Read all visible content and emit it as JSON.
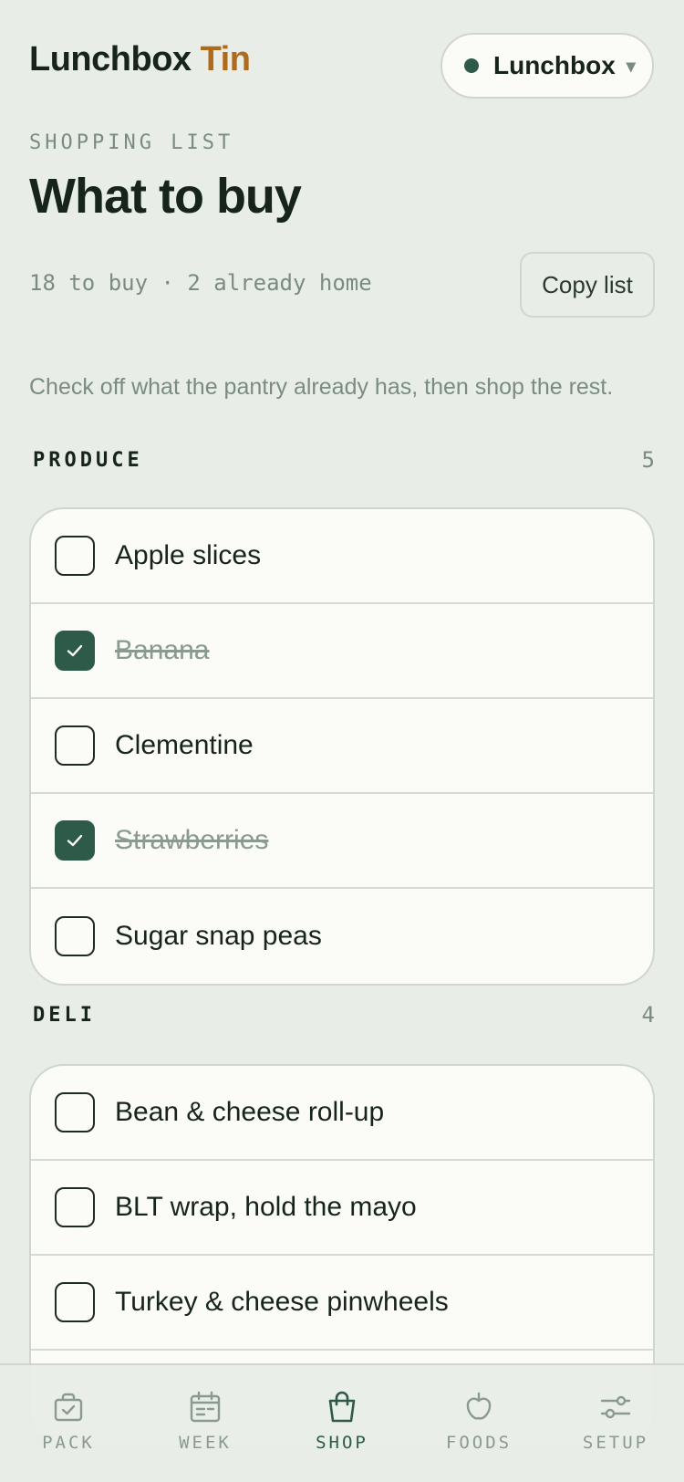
{
  "header": {
    "brand_main": "Lunchbox",
    "brand_accent": "Tin",
    "profile_label": "Lunchbox",
    "profile_chevron": "▾"
  },
  "page": {
    "eyebrow": "SHOPPING LIST",
    "title": "What to buy",
    "summary": "18 to buy · 2 already home",
    "copy_button": "Copy list",
    "helper": "Check off what the pantry already has, then shop the rest."
  },
  "sections": [
    {
      "name": "PRODUCE",
      "count": "5",
      "items": [
        {
          "label": "Apple slices",
          "checked": false
        },
        {
          "label": "Banana",
          "checked": true
        },
        {
          "label": "Clementine",
          "checked": false
        },
        {
          "label": "Strawberries",
          "checked": true
        },
        {
          "label": "Sugar snap peas",
          "checked": false
        }
      ]
    },
    {
      "name": "DELI",
      "count": "4",
      "items": [
        {
          "label": "Bean & cheese roll-up",
          "checked": false
        },
        {
          "label": "BLT wrap, hold the mayo",
          "checked": false
        },
        {
          "label": "Turkey & cheese pinwheels",
          "checked": false
        }
      ]
    }
  ],
  "nav": [
    {
      "label": "PACK",
      "icon": "lunchbox-check-icon",
      "active": false
    },
    {
      "label": "WEEK",
      "icon": "calendar-icon",
      "active": false
    },
    {
      "label": "SHOP",
      "icon": "shopping-bag-icon",
      "active": true
    },
    {
      "label": "FOODS",
      "icon": "apple-icon",
      "active": false
    },
    {
      "label": "SETUP",
      "icon": "sliders-icon",
      "active": false
    }
  ],
  "colors": {
    "background": "#e8ede7",
    "accent_green": "#2e5a4a",
    "brand_orange": "#b06a1c",
    "muted_text": "#7a8c82"
  }
}
